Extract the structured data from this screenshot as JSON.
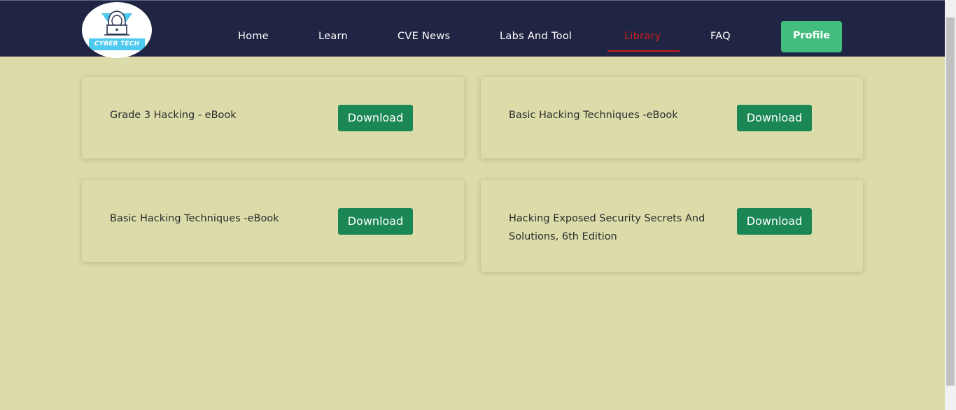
{
  "nav": {
    "logo_text": "CYBER TECH",
    "links": [
      {
        "label": "Home"
      },
      {
        "label": "Learn"
      },
      {
        "label": "CVE News"
      },
      {
        "label": "Labs And Tool"
      },
      {
        "label": "Library",
        "active": true
      },
      {
        "label": "FAQ"
      }
    ],
    "profile_label": "Profile"
  },
  "colors": {
    "navbar_bg": "#212544",
    "page_bg": "#dcdcab",
    "active_link": "#cc1f1f",
    "download_button": "#1a8754",
    "profile_button": "#43bd7e"
  },
  "library": {
    "books": [
      {
        "title": "Grade 3 Hacking - eBook",
        "button_label": "Download"
      },
      {
        "title": "Basic Hacking Techniques -eBook",
        "button_label": "Download"
      },
      {
        "title": "Basic Hacking Techniques -eBook",
        "button_label": "Download"
      },
      {
        "title": "Hacking Exposed Security Secrets And Solutions, 6th Edition",
        "button_label": "Download"
      }
    ]
  }
}
